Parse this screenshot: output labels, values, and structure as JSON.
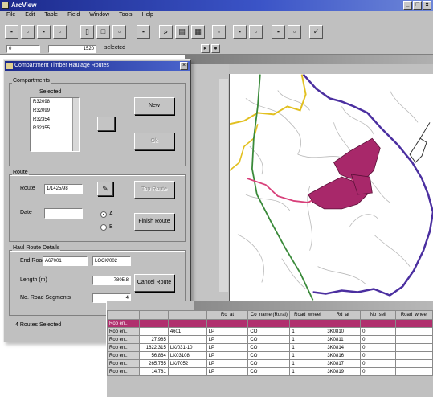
{
  "window": {
    "title": "ArcView"
  },
  "menu": [
    "File",
    "Edit",
    "Table",
    "Field",
    "Window",
    "Tools",
    "Help"
  ],
  "toolbar": {
    "icons": [
      "save-icon",
      "open-icon",
      "print-icon",
      "cut-icon",
      "copy-icon",
      "paste-icon",
      "select-icon",
      "query-icon",
      "zoom-icon",
      "info-icon",
      "find-icon",
      "chart-icon",
      "layout-icon",
      "table-icon",
      "edit-icon",
      "map-icon",
      "check-icon"
    ]
  },
  "status": {
    "count_a": "0",
    "count_b": "1520",
    "selected_label": "selected"
  },
  "dialog": {
    "title": "Compartment Timber Haulage Routes",
    "compartments_label": "Compartments",
    "selected_label": "Selected",
    "list_items": [
      "R32098",
      "R32099",
      "R32354",
      "R32355"
    ],
    "new_button": "New",
    "ok_button": "Ok",
    "route_label": "Route",
    "route_field": "1/1425/98",
    "route_field_label": "Route",
    "date_label": "Date",
    "date_value": "",
    "radio_a": "A",
    "radio_b": "B",
    "top_route_button": "Top Route",
    "finish_route_button": "Finish Route",
    "haul_details_label": "Haul Route Details",
    "end_road_label": "End Road",
    "end_road_value": "A67001",
    "end_road_value2": "LOCK/002",
    "length_label": "Length (m)",
    "length_value": "7805.8",
    "no_road_segments_label": "No. Road Segments",
    "no_road_segments_value": "4",
    "cancel_route_button": "Cancel Route",
    "footer_text": "4 Routes Selected"
  },
  "table": {
    "columns": [
      "",
      "",
      "",
      "Ro_at",
      "Co_name (Rural)",
      "Road_wheel",
      "Rd_at",
      "No_sell",
      "Road_wheel"
    ],
    "rows": [
      [
        "Rob en..",
        "",
        "",
        "",
        "",
        "",
        "",
        "",
        ""
      ],
      [
        "Rob en..",
        "",
        "4601",
        "LP",
        "CO",
        "1",
        "3K0810",
        "0",
        ""
      ],
      [
        "Rob en..",
        "27.985",
        "",
        "LP",
        "CO",
        "1",
        "3K0811",
        "0",
        ""
      ],
      [
        "Rob en..",
        "1622.315",
        "LK/031-10",
        "LP",
        "CO",
        "1",
        "3K0814",
        "0",
        ""
      ],
      [
        "Rob en..",
        "56.864",
        "LK03108",
        "LP",
        "CO",
        "1",
        "3K0816",
        "0",
        ""
      ],
      [
        "Rob en..",
        "265.755",
        "LK/7052",
        "LP",
        "CO",
        "1",
        "3K0817",
        "0",
        ""
      ],
      [
        "Rob en..",
        "14.781",
        "",
        "LP",
        "CO",
        "1",
        "3K0819",
        "0",
        ""
      ]
    ],
    "selected_row": 0
  },
  "colors": {
    "route_purple": "#4b2fa0",
    "compartment_magenta": "#a8286a",
    "road_yellow": "#e2c020",
    "river_green": "#3a8a3a",
    "road_pink": "#d8407a"
  }
}
